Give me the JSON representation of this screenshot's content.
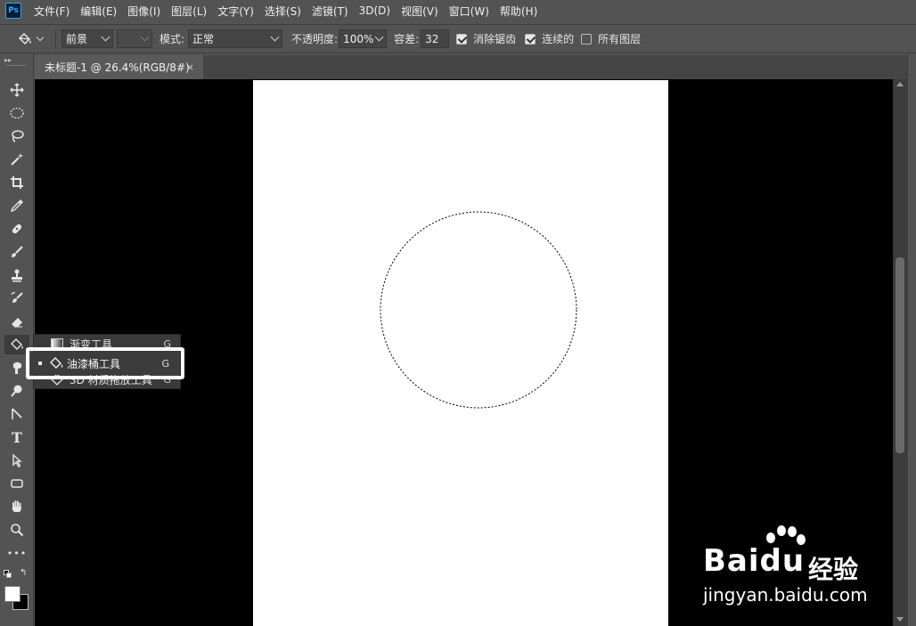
{
  "app": {
    "logo": "Ps",
    "menu": [
      "文件(F)",
      "编辑(E)",
      "图像(I)",
      "图层(L)",
      "文字(Y)",
      "选择(S)",
      "滤镜(T)",
      "3D(D)",
      "视图(V)",
      "窗口(W)",
      "帮助(H)"
    ]
  },
  "options": {
    "fill_source": "前景",
    "mode_label": "模式:",
    "mode_value": "正常",
    "opacity_label": "不透明度:",
    "opacity_value": "100%",
    "tolerance_label": "容差:",
    "tolerance_value": "32",
    "antialias_label": "消除锯齿",
    "antialias_checked": true,
    "contiguous_label": "连续的",
    "contiguous_checked": true,
    "all_layers_label": "所有图层",
    "all_layers_checked": false
  },
  "document": {
    "tab_title": "未标题-1 @ 26.4%(RGB/8#)",
    "tab_close": "×",
    "background_color": "#000000",
    "canvas_color": "#ffffff"
  },
  "flyout": {
    "items": [
      {
        "label": "渐变工具",
        "shortcut": "G",
        "icon": "gradient-icon"
      },
      {
        "label": "油漆桶工具",
        "shortcut": "G",
        "icon": "paint-bucket-icon",
        "selected": true
      },
      {
        "label": "3D 材质拖放工具",
        "shortcut": "G",
        "icon": "material-drop-icon"
      }
    ]
  },
  "toolbar": {
    "tools": [
      "move",
      "ellipse-marquee",
      "lasso",
      "magic-wand",
      "crop",
      "eyedropper",
      "healing-brush",
      "brush",
      "clone-stamp",
      "history-brush",
      "eraser",
      "paint-bucket",
      "smudge",
      "dodge",
      "pen",
      "type",
      "path-select",
      "rectangle",
      "hand",
      "zoom",
      "more"
    ],
    "type_tool_glyph": "T",
    "more_glyph": "•••"
  },
  "watermark": {
    "brand": "Bai",
    "brand_du": "du",
    "cn": "经验",
    "url": "jingyan.baidu.com"
  }
}
